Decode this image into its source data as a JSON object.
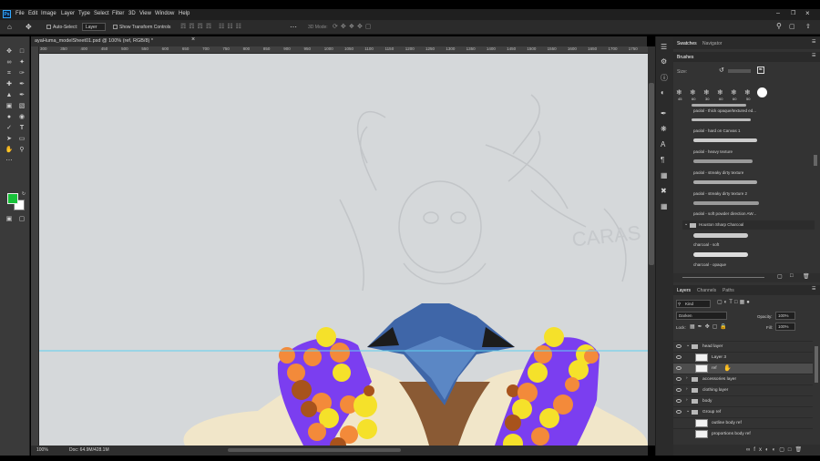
{
  "menu": {
    "app_icon": "Ps",
    "items": [
      "File",
      "Edit",
      "Image",
      "Layer",
      "Type",
      "Select",
      "Filter",
      "3D",
      "View",
      "Window",
      "Help"
    ]
  },
  "options": {
    "auto_select_label": "Auto-Select:",
    "auto_select_value": "Layer",
    "transform_label": "Show Transform Controls",
    "mode_3d": "3D Mode:"
  },
  "document": {
    "tab_title": "ayaHuma_modelSheet01.psd @ 100% (ref, RGB/8) *",
    "zoom": "100%",
    "doc_info": "Doc: 64.9M/428.1M"
  },
  "ruler": {
    "ticks": [
      "300",
      "350",
      "400",
      "450",
      "500",
      "550",
      "600",
      "650",
      "700",
      "750",
      "800",
      "850",
      "900",
      "950",
      "1000",
      "1050",
      "1100",
      "1150",
      "1200",
      "1250",
      "1300",
      "1350",
      "1400",
      "1450",
      "1500",
      "1550",
      "1600",
      "1650",
      "1700",
      "1750"
    ]
  },
  "panels": {
    "swatches_tab": "Swatches",
    "navigator_tab": "Navigator",
    "brushes_tab": "Brushes",
    "size_label": "Size:",
    "preset_sizes": [
      "45",
      "60",
      "30",
      "60",
      "60",
      "50",
      ""
    ],
    "brushes": [
      "paolal - thick opaque/textured ed...",
      "paolal - hard on Canvas 1",
      "paolal - heavy texture",
      "paolal - streaky dirty texture",
      "paolal - streaky dirty texture 2",
      "paolal - soft powder direction AW..."
    ],
    "brush_group": "Houston Sharp Charcoal",
    "charcoal_brushes": [
      "charcoal - soft",
      "charcoal - opaque"
    ]
  },
  "layers": {
    "tabs": [
      "Layers",
      "Channels",
      "Paths"
    ],
    "kind_label": "Kind",
    "blend_mode": "Darken",
    "opacity_label": "Opacity:",
    "opacity_value": "100%",
    "lock_label": "Lock:",
    "fill_label": "Fill:",
    "fill_value": "100%",
    "items": [
      {
        "name": "head layer",
        "type": "folder",
        "indent": 0,
        "expanded": true
      },
      {
        "name": "Layer 3",
        "type": "layer",
        "indent": 1
      },
      {
        "name": "ref",
        "type": "layer",
        "indent": 1,
        "selected": true
      },
      {
        "name": "accessories layer",
        "type": "folder",
        "indent": 0
      },
      {
        "name": "clothing layer",
        "type": "folder",
        "indent": 0
      },
      {
        "name": "body",
        "type": "folder",
        "indent": 0
      },
      {
        "name": "Group ref",
        "type": "folder",
        "indent": 0,
        "expanded": true
      },
      {
        "name": "outline body ref",
        "type": "layer",
        "indent": 1
      },
      {
        "name": "proportions body ref",
        "type": "layer",
        "indent": 1
      }
    ]
  },
  "colors": {
    "foreground": "#18c23a",
    "background": "#ffffff",
    "canvas_bg": "#d5d8da",
    "guide": "#5fd0f0"
  },
  "canvas_text": "CARAS"
}
